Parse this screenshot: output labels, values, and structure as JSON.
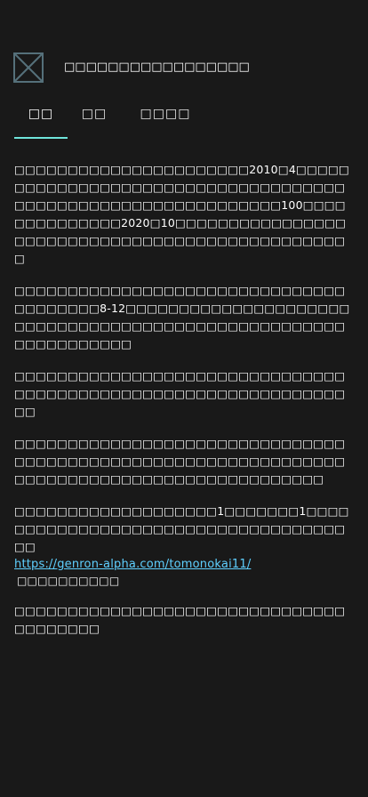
{
  "header": {
    "logo_icon": "broken-image-icon",
    "title": "□□□□□□□□□□□□□□□□□"
  },
  "tabs": [
    {
      "label": "□□",
      "active": true
    },
    {
      "label": "□□",
      "active": false
    },
    {
      "label": "□□□□",
      "active": false
    }
  ],
  "content": {
    "paragraph1": "□□□□□□□□□□□□□□□□□□□□□□2010□4□□□□□□□□□□□□□□□□□□□□□□□□□□□□□□□□□□□□□□□□□□□□□□□□□□□□□□□□□□□□□100□□□□□□□□□□□□□□2020□10□□□□□□□□□□□□□□□□□□□□□□□□□□□□□□□□□□□□□□□□□□□□□□□□",
    "paragraph2": "□□□□□□□□□□□□□□□□□□□□□□□□□□□□□□□□□□□□□□□8-12□□□□□□□□□□□□□□□□□□□□□□□□□□□□□□□□□□□□□□□□□□□□□□□□□□□□□□□□□□□□□□□",
    "paragraph3": "□□□□□□□□□□□□□□□□□□□□□□□□□□□□□□□□□□□□□□□□□□□□□□□□□□□□□□□□□□□□□□□□",
    "paragraph4": "□□□□□□□□□□□□□□□□□□□□□□□□□□□□□□□□□□□□□□□□□□□□□□□□□□□□□□□□□□□□□□□□□□□□□□□□□□□□□□□□□□□□□□□□□□□",
    "paragraph5_text": "□□□□□□□□□□□□□□□□□□□1□□□□□□□1□□□□□□□□□□□□□□□□□□□□□□□□□□□□□□□□□□□□□",
    "paragraph5_link": "https://genron-alpha.com/tomonokai11/",
    "paragraph5_note": "□□□□□□□□□□",
    "paragraph6": "□□□□□□□□□□□□□□□□□□□□□□□□□□□□□□□□□□□□□□□"
  },
  "colors": {
    "background": "#191919",
    "text": "#ffffff",
    "tab_indicator": "#6fe4db",
    "link": "#5fd0ff"
  }
}
